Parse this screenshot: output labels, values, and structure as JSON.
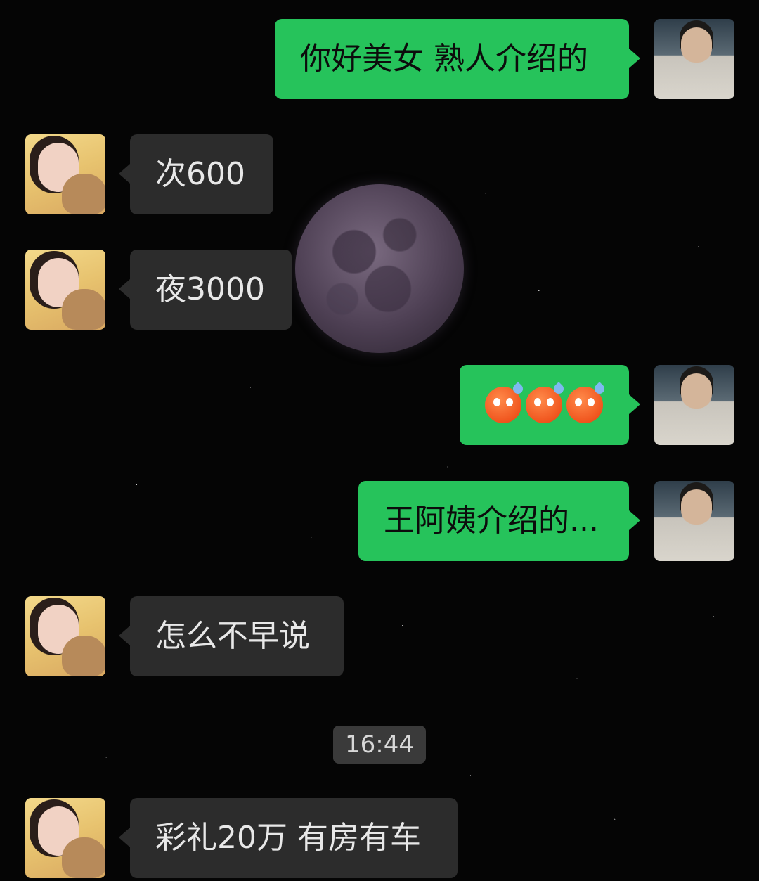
{
  "chat": {
    "messages": [
      {
        "sender": "self",
        "type": "text",
        "text": "你好美女 熟人介绍的"
      },
      {
        "sender": "other",
        "type": "text",
        "text": "次600"
      },
      {
        "sender": "other",
        "type": "text",
        "text": "夜3000"
      },
      {
        "sender": "self",
        "type": "emoji",
        "emojis": [
          "anxious-sweat-face",
          "anxious-sweat-face",
          "anxious-sweat-face"
        ]
      },
      {
        "sender": "self",
        "type": "text",
        "text": "王阿姨介绍的..."
      },
      {
        "sender": "other",
        "type": "text",
        "text": "怎么不早说"
      },
      {
        "sender": "other",
        "type": "text",
        "text": "彩礼20万 有房有车"
      }
    ],
    "timestamp": "16:44"
  },
  "colors": {
    "self_bubble": "#26c35b",
    "other_bubble": "#2c2c2c",
    "background": "#050505"
  }
}
